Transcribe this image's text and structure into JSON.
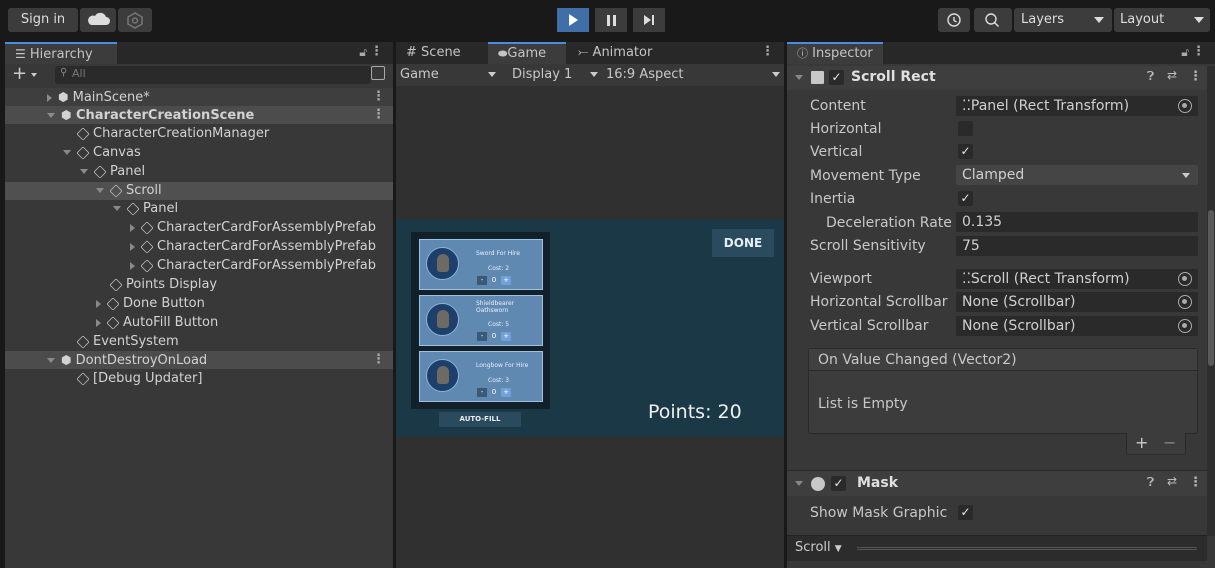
{
  "toolbar": {
    "sign_in": "Sign in",
    "layers": "Layers",
    "layout": "Layout"
  },
  "hierarchy": {
    "tab": "Hierarchy",
    "search_placeholder": "All",
    "rows": [
      {
        "label": "MainScene*"
      },
      {
        "label": "CharacterCreationScene"
      },
      {
        "label": "CharacterCreationManager"
      },
      {
        "label": "Canvas"
      },
      {
        "label": "Panel"
      },
      {
        "label": "Scroll"
      },
      {
        "label": "Panel"
      },
      {
        "label": "CharacterCardForAssemblyPrefab"
      },
      {
        "label": "CharacterCardForAssemblyPrefab"
      },
      {
        "label": "CharacterCardForAssemblyPrefab"
      },
      {
        "label": "Points Display"
      },
      {
        "label": "Done Button"
      },
      {
        "label": "AutoFill Button"
      },
      {
        "label": "EventSystem"
      },
      {
        "label": "DontDestroyOnLoad"
      },
      {
        "label": "[Debug Updater]"
      }
    ]
  },
  "game": {
    "tabs": {
      "scene": "Scene",
      "game": "Game",
      "animator": "Animator"
    },
    "game_dropdown": "Game",
    "display": "Display 1",
    "aspect": "16:9 Aspect",
    "cards": [
      {
        "name": "Sword For Hire",
        "cost": "Cost: 2",
        "count": "0"
      },
      {
        "name": "Shieldbearer Oathsworn",
        "cost": "Cost: 5",
        "count": "0"
      },
      {
        "name": "Longbow For Hire",
        "cost": "Cost: 3",
        "count": "0"
      }
    ],
    "minus": "-",
    "plus": "+",
    "done": "DONE",
    "autofill": "AUTO-FILL",
    "points": "Points: 20"
  },
  "inspector": {
    "tab": "Inspector",
    "scroll_rect": {
      "title": "Scroll Rect",
      "content_label": "Content",
      "content_value": "Panel (Rect Transform)",
      "horizontal_label": "Horizontal",
      "horizontal_checked": false,
      "vertical_label": "Vertical",
      "vertical_checked": true,
      "movement_label": "Movement Type",
      "movement_value": "Clamped",
      "inertia_label": "Inertia",
      "inertia_checked": true,
      "decel_label": "Deceleration Rate",
      "decel_value": "0.135",
      "sens_label": "Scroll Sensitivity",
      "sens_value": "75",
      "viewport_label": "Viewport",
      "viewport_value": "Scroll (Rect Transform)",
      "hscroll_label": "Horizontal Scrollbar",
      "hscroll_value": "None (Scrollbar)",
      "vscroll_label": "Vertical Scrollbar",
      "vscroll_value": "None (Scrollbar)",
      "event_title": "On Value Changed (Vector2)",
      "event_empty": "List is Empty",
      "add": "+",
      "remove": "−"
    },
    "mask": {
      "title": "Mask",
      "show_label": "Show Mask Graphic",
      "show_checked": true
    },
    "bottom_label": "Scroll"
  },
  "colors": {
    "accent": "#4a8cdf",
    "game_bg": "#1a3845",
    "card": "#5f89b1",
    "done_bg": "#2a4a5e"
  }
}
